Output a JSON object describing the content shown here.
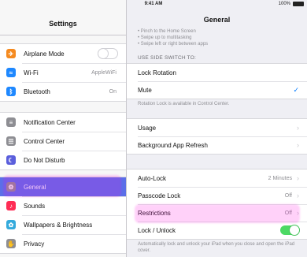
{
  "status": {
    "device": "iPad",
    "time": "9:41 AM",
    "battery": "100%"
  },
  "sidebar": {
    "title": "Settings",
    "group1": [
      {
        "label": "Airplane Mode",
        "icon": "airplane-icon",
        "color": "#f58a1f",
        "value": ""
      },
      {
        "label": "Wi-Fi",
        "icon": "wifi-icon",
        "color": "#1e88ff",
        "value": "AppleWiFi"
      },
      {
        "label": "Bluetooth",
        "icon": "bluetooth-icon",
        "color": "#1e88ff",
        "value": "On"
      }
    ],
    "group2": [
      {
        "label": "Notification Center",
        "icon": "notification-center-icon",
        "color": "#8e8e93"
      },
      {
        "label": "Control Center",
        "icon": "control-center-icon",
        "color": "#8e8e93"
      },
      {
        "label": "Do Not Disturb",
        "icon": "moon-icon",
        "color": "#5b5fdc"
      }
    ],
    "group3": [
      {
        "label": "General",
        "icon": "gear-icon",
        "color": "#8e8e93",
        "active": true
      },
      {
        "label": "Sounds",
        "icon": "speaker-icon",
        "color": "#ff2d55"
      },
      {
        "label": "Wallpapers & Brightness",
        "icon": "wallpaper-icon",
        "color": "#34aadc"
      },
      {
        "label": "Privacy",
        "icon": "privacy-icon",
        "color": "#8e8e93"
      }
    ]
  },
  "main": {
    "title": "General",
    "gestures_hint_lines": [
      "• Pinch to the Home Screen",
      "• Swipe up to multitasking",
      "• Swipe left or right between apps"
    ],
    "side_switch_header": "USE SIDE SWITCH TO:",
    "side_switch_rows": [
      {
        "label": "Lock Rotation",
        "checked": false
      },
      {
        "label": "Mute",
        "checked": true
      }
    ],
    "rotation_hint": "Rotation Lock is available in Control Center.",
    "usage_rows": [
      {
        "label": "Usage"
      },
      {
        "label": "Background App Refresh"
      }
    ],
    "lock_rows": [
      {
        "label": "Auto-Lock",
        "value": "2 Minutes"
      },
      {
        "label": "Passcode Lock",
        "value": "Off"
      },
      {
        "label": "Restrictions",
        "value": "Off"
      },
      {
        "label": "Lock / Unlock",
        "toggle": "on"
      }
    ],
    "lock_hint": "Automatically lock and unlock your iPad when you close and open the iPad cover."
  },
  "colors": {
    "active_row": "#5b6fe8",
    "toggle_on": "#4cd964",
    "checkmark": "#007aff"
  }
}
